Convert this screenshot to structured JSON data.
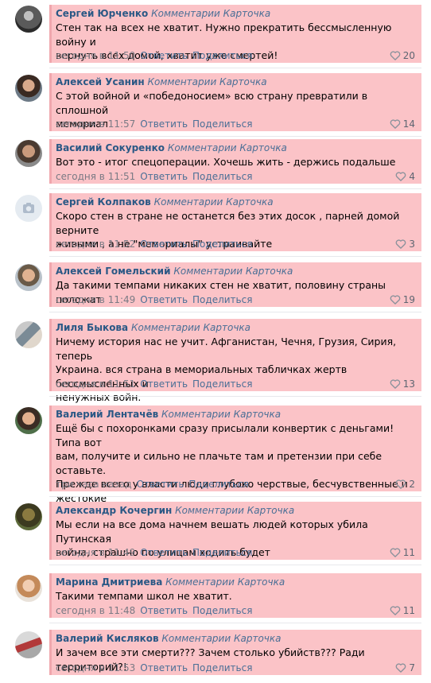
{
  "comments": [
    {
      "author": "Сергей Юрченко",
      "where": "Комментарии Карточка",
      "lines": [
        "Стен так на всех не хватит. Нужно прекратить бессмысленную войну и",
        "вернуть всех домой, хватит уже смертей!"
      ],
      "time": "сегодня в 11:50",
      "reply": "Ответить",
      "share": "Поделиться",
      "likes": "20",
      "avatar_icon": "avatar-photo-icon"
    },
    {
      "author": "Алексей Усанин",
      "where": "Комментарии Карточка",
      "lines": [
        "С этой войной и «победоносием» всю страну превратили в сплошной",
        "мемориал"
      ],
      "time": "сегодня в 11:57",
      "reply": "Ответить",
      "share": "Поделиться",
      "likes": "14",
      "avatar_icon": "avatar-photo-icon"
    },
    {
      "author": "Василий Сокуренко",
      "where": "Комментарии Карточка",
      "lines": [
        "Вот это - итог спецоперации. Хочешь жить - держись подальше"
      ],
      "time": "сегодня в 11:51",
      "reply": "Ответить",
      "share": "Поделиться",
      "likes": "4",
      "avatar_icon": "avatar-photo-icon"
    },
    {
      "author": "Сергей Колпаков",
      "where": "Комментарии Карточка",
      "lines": [
        "Скоро стен в стране не останется без этих досок , парней домой верните",
        "живыми , а не \"мемориалы\" устраивайте"
      ],
      "time": "сегодня в 11:52",
      "reply": "Ответить",
      "share": "Поделиться",
      "likes": "3",
      "avatar_icon": "camera-placeholder-icon"
    },
    {
      "author": "Алексей Гомельский",
      "where": "Комментарии Карточка",
      "lines": [
        "Да такими темпами никаких стен не хватит, половину страны положат"
      ],
      "time": "сегодня в 11:49",
      "reply": "Ответить",
      "share": "Поделиться",
      "likes": "19",
      "avatar_icon": "avatar-photo-icon"
    },
    {
      "author": "Лиля Быкова",
      "where": "Комментарии Карточка",
      "lines": [
        "Ничему история нас не учит. Афганистан, Чечня, Грузия, Сирия, теперь",
        "Украина. вся страна в мемориальных табличках жертв бессмысленных и",
        "ненужных войн."
      ],
      "time": "сегодня в 11:51",
      "reply": "Ответить",
      "share": "Поделиться",
      "likes": "13",
      "avatar_icon": "avatar-photo-icon"
    },
    {
      "author": "Валерий Лентачёв",
      "where": "Комментарии Карточка",
      "lines": [
        "Ещё бы с похоронками сразу присылали конвертик с деньгами! Типа вот",
        "вам, получите и сильно не плачьте там и претензии при себе оставьте.",
        "Прежде всего у власти люди глубоко черствые, бесчувственные и",
        "жестокие"
      ],
      "time": "три часа назад",
      "reply": "Ответить",
      "share": "Поделиться",
      "likes": "2",
      "avatar_icon": "avatar-photo-icon"
    },
    {
      "author": "Александр Кочергин",
      "where": "Комментарии Карточка",
      "lines": [
        "Мы если на все дома начнем вешать людей которых убила Путинская",
        "война, страшно по улицам ходить будет"
      ],
      "time": "сегодня в 11:49",
      "reply": "Ответить",
      "share": "Поделиться",
      "likes": "11",
      "avatar_icon": "avatar-photo-icon"
    },
    {
      "author": "Марина Дмитриева",
      "where": "Комментарии Карточка",
      "lines": [
        "Такими темпами школ не хватит."
      ],
      "time": "сегодня в 11:48",
      "reply": "Ответить",
      "share": "Поделиться",
      "likes": "11",
      "avatar_icon": "avatar-photo-icon"
    },
    {
      "author": "Валерий Кисляков",
      "where": "Комментарии Карточка",
      "lines": [
        "И зачем все эти смерти??? Зачем столько убийств??? Ради территорий?!"
      ],
      "time": "сегодня в 11:53",
      "reply": "Ответить",
      "share": "Поделиться",
      "likes": "7",
      "avatar_icon": "avatar-photo-icon"
    }
  ],
  "colors": {
    "highlight": "#fbc3c7",
    "author": "#2a5885",
    "link": "#4a6f96"
  }
}
